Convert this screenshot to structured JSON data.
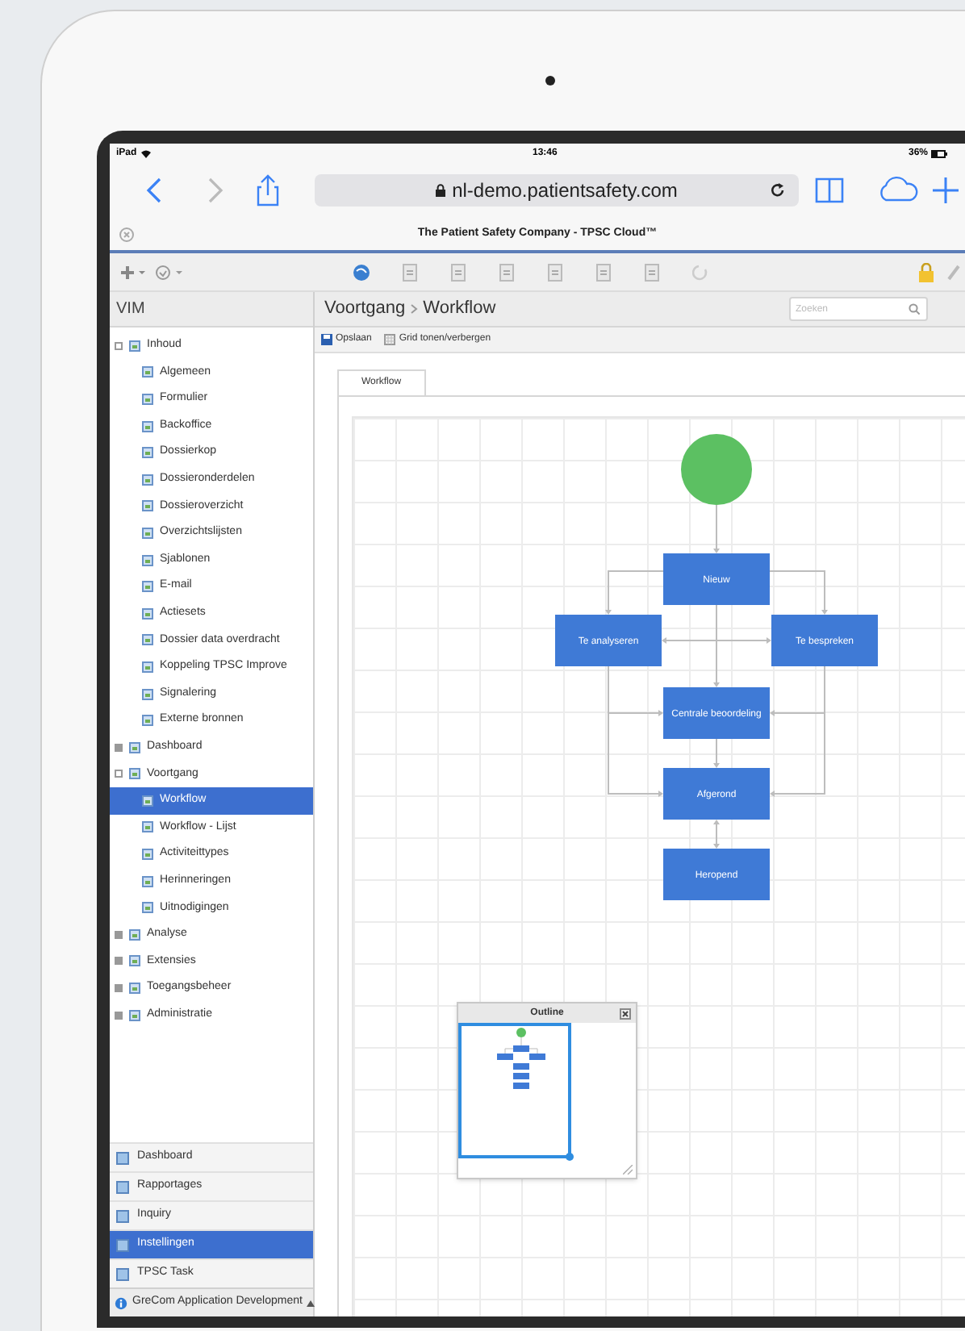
{
  "status_bar": {
    "device": "iPad",
    "time": "13:46",
    "battery": "36%"
  },
  "browser": {
    "url": "nl-demo.patientsafety.com",
    "page_title": "The Patient Safety Company - TPSC Cloud™"
  },
  "sidebar": {
    "title": "VIM",
    "tree": [
      {
        "label": "Inhoud",
        "expanded": true,
        "selected": false,
        "children": [
          {
            "label": "Algemeen",
            "selected": false
          },
          {
            "label": "Formulier",
            "selected": false
          },
          {
            "label": "Backoffice",
            "selected": false
          },
          {
            "label": "Dossierkop",
            "selected": false
          },
          {
            "label": "Dossieronderdelen",
            "selected": false
          },
          {
            "label": "Dossieroverzicht",
            "selected": false
          },
          {
            "label": "Overzichtslijsten",
            "selected": false
          },
          {
            "label": "Sjablonen",
            "selected": false
          },
          {
            "label": "E-mail",
            "selected": false
          },
          {
            "label": "Actiesets",
            "selected": false
          },
          {
            "label": "Dossier data overdracht",
            "selected": false
          },
          {
            "label": "Koppeling TPSC Improve",
            "selected": false
          },
          {
            "label": "Signalering",
            "selected": false
          },
          {
            "label": "Externe bronnen",
            "selected": false
          }
        ]
      },
      {
        "label": "Dashboard",
        "expanded": false,
        "selected": false
      },
      {
        "label": "Voortgang",
        "expanded": true,
        "selected": false,
        "children": [
          {
            "label": "Workflow",
            "selected": true
          },
          {
            "label": "Workflow - Lijst",
            "selected": false
          },
          {
            "label": "Activiteittypes",
            "selected": false
          },
          {
            "label": "Herinneringen",
            "selected": false
          },
          {
            "label": "Uitnodigingen",
            "selected": false
          }
        ]
      },
      {
        "label": "Analyse",
        "expanded": false,
        "selected": false
      },
      {
        "label": "Extensies",
        "expanded": false,
        "selected": false
      },
      {
        "label": "Toegangsbeheer",
        "expanded": false,
        "selected": false
      },
      {
        "label": "Administratie",
        "expanded": false,
        "selected": false
      }
    ],
    "nav": [
      {
        "label": "Dashboard",
        "selected": false
      },
      {
        "label": "Rapportages",
        "selected": false
      },
      {
        "label": "Inquiry",
        "selected": false
      },
      {
        "label": "Instellingen",
        "selected": true
      },
      {
        "label": "TPSC Task",
        "selected": false
      }
    ],
    "footer": "GreCom Application Development"
  },
  "content": {
    "breadcrumb": [
      "Voortgang",
      "Workflow"
    ],
    "search": {
      "placeholder": "Zoeken"
    },
    "toolbar": [
      "Opslaan",
      "Grid tonen/verbergen"
    ],
    "tabs": [
      {
        "label": "Workflow",
        "selected": true
      }
    ],
    "diagram": {
      "nodes": [
        {
          "kind": "start"
        },
        {
          "kind": "state",
          "label": "Nieuw"
        },
        {
          "kind": "state",
          "label": "Te analyseren"
        },
        {
          "kind": "state",
          "label": "Te bespreken"
        },
        {
          "kind": "state",
          "label": "Centrale beoordeling"
        },
        {
          "kind": "state",
          "label": "Afgerond"
        },
        {
          "kind": "state",
          "label": "Heropend"
        }
      ]
    },
    "outline": {
      "title": "Outline"
    }
  }
}
